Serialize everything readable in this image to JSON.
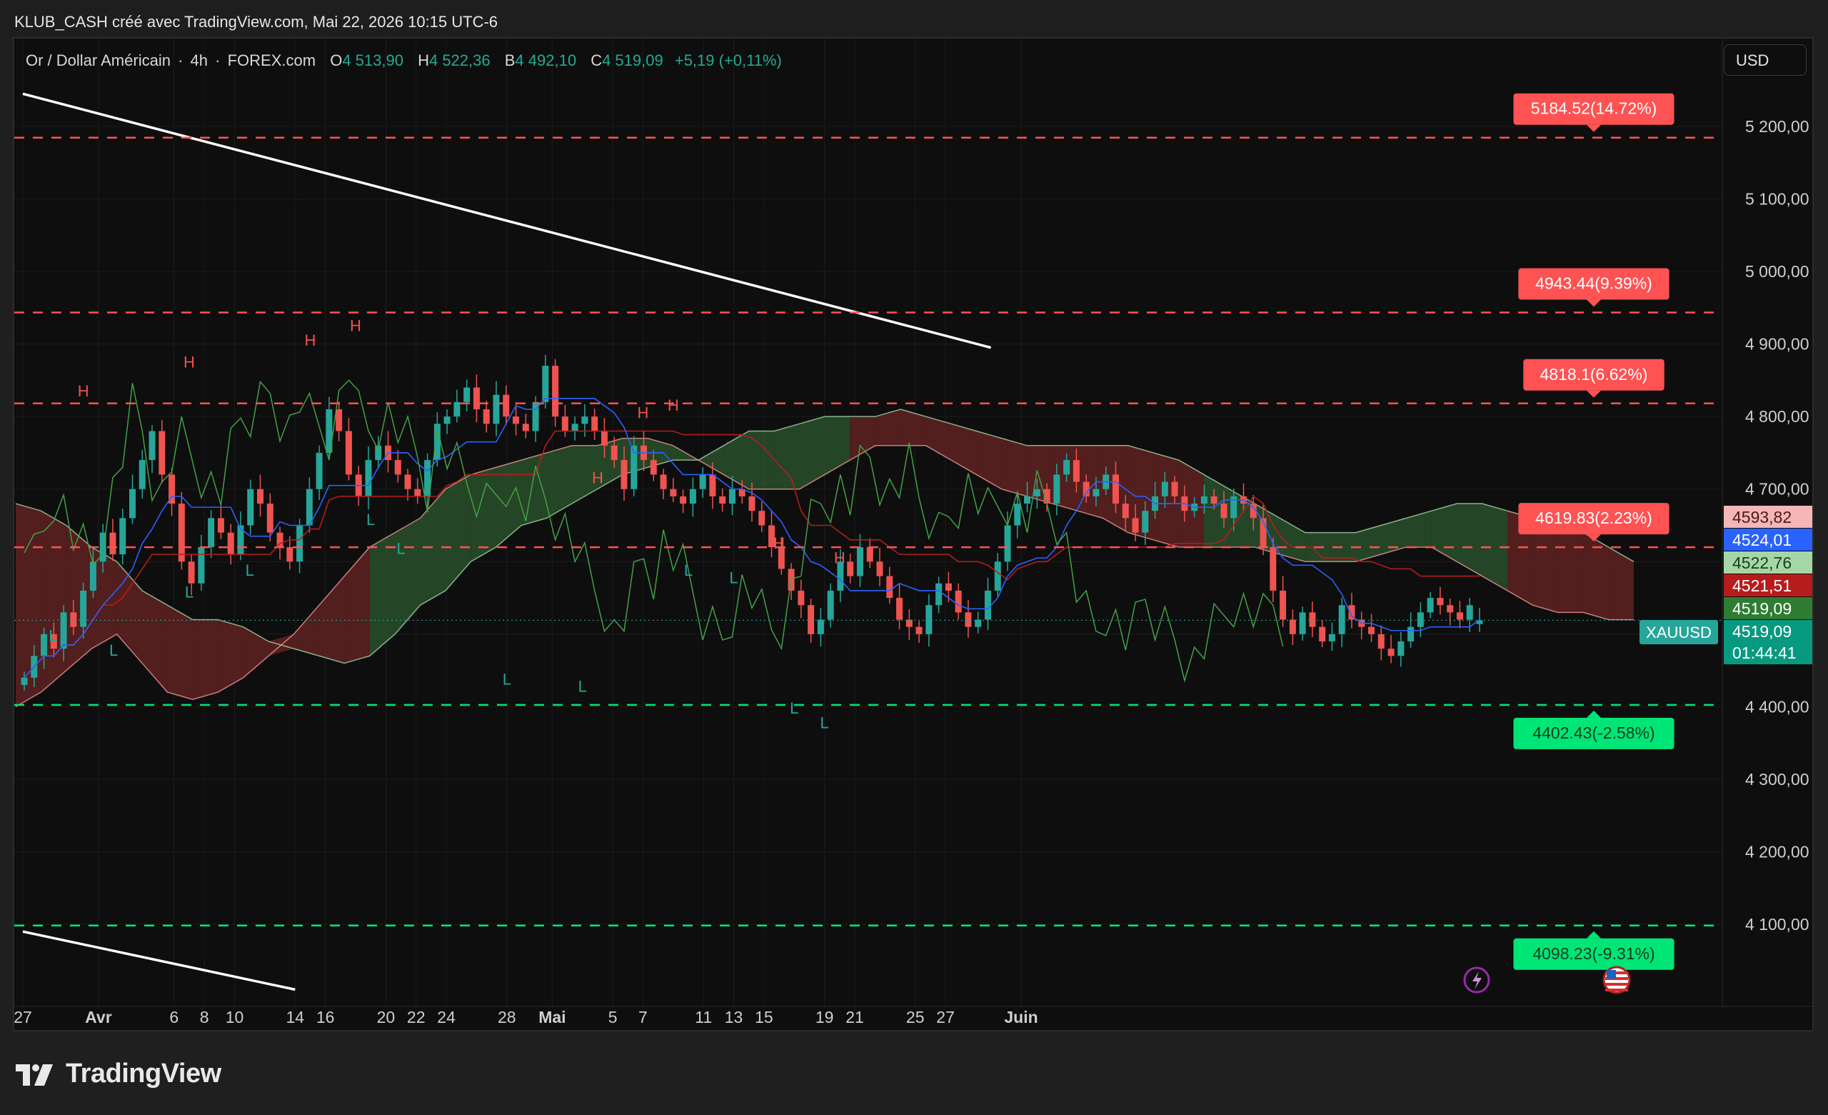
{
  "header": {
    "credit": "KLUB_CASH créé avec TradingView.com, Mai 22, 2026 10:15 UTC-6"
  },
  "legend": {
    "symbol_desc": "Or / Dollar Américain",
    "interval": "4h",
    "exchange": "FOREX.com",
    "open_label": "O",
    "open": "4 513,90",
    "high_label": "H",
    "high": "4 522,36",
    "low_label": "B",
    "low": "4 492,10",
    "close_label": "C",
    "close": "4 519,09",
    "change": "+5,19 (+0,11%)"
  },
  "currency": "USD",
  "footer": {
    "brand": "TradingView"
  },
  "colors": {
    "background": "#0e0e0e",
    "grid": "#1c1c1c",
    "up": "#26a69a",
    "down": "#ef5350",
    "resistance": "#ff5252",
    "support": "#00e676",
    "trendline": "#ffffff",
    "cloud_bull": "#2d5a2f",
    "cloud_bear": "#6b2424",
    "kijun": "#b71c1c",
    "tenkan": "#2962ff",
    "chikou": "#43a047"
  },
  "chart_data": {
    "type": "candlestick",
    "symbol": "XAUUSD",
    "interval": "4h",
    "y_scale": {
      "min": 4000,
      "max": 5300
    },
    "y_ticks": [
      {
        "value": 5200,
        "label": "5 200,00"
      },
      {
        "value": 5100,
        "label": "5 100,00"
      },
      {
        "value": 5000,
        "label": "5 000,00"
      },
      {
        "value": 4900,
        "label": "4 900,00"
      },
      {
        "value": 4800,
        "label": "4 800,00"
      },
      {
        "value": 4700,
        "label": "4 700,00"
      },
      {
        "value": 4400,
        "label": "4 400,00"
      },
      {
        "value": 4300,
        "label": "4 300,00"
      },
      {
        "value": 4200,
        "label": "4 200,00"
      },
      {
        "value": 4100,
        "label": "4 100,00"
      }
    ],
    "x_ticks": [
      {
        "label": "27",
        "date": "2026-03-27"
      },
      {
        "label": "Avr",
        "date": "2026-04-01",
        "bold": true
      },
      {
        "label": "6",
        "date": "2026-04-06"
      },
      {
        "label": "8",
        "date": "2026-04-08"
      },
      {
        "label": "10",
        "date": "2026-04-10"
      },
      {
        "label": "14",
        "date": "2026-04-14"
      },
      {
        "label": "16",
        "date": "2026-04-16"
      },
      {
        "label": "20",
        "date": "2026-04-20"
      },
      {
        "label": "22",
        "date": "2026-04-22"
      },
      {
        "label": "24",
        "date": "2026-04-24"
      },
      {
        "label": "28",
        "date": "2026-04-28"
      },
      {
        "label": "Mai",
        "date": "2026-05-01",
        "bold": true
      },
      {
        "label": "5",
        "date": "2026-05-05"
      },
      {
        "label": "7",
        "date": "2026-05-07"
      },
      {
        "label": "11",
        "date": "2026-05-11"
      },
      {
        "label": "13",
        "date": "2026-05-13"
      },
      {
        "label": "15",
        "date": "2026-05-15"
      },
      {
        "label": "19",
        "date": "2026-05-19"
      },
      {
        "label": "21",
        "date": "2026-05-21"
      },
      {
        "label": "25",
        "date": "2026-05-25"
      },
      {
        "label": "27",
        "date": "2026-05-27"
      },
      {
        "label": "Juin",
        "date": "2026-06-01",
        "bold": true
      }
    ],
    "closes": [
      4440,
      4470,
      4500,
      4480,
      4530,
      4510,
      4560,
      4600,
      4640,
      4610,
      4660,
      4700,
      4740,
      4780,
      4720,
      4680,
      4600,
      4570,
      4620,
      4660,
      4640,
      4610,
      4650,
      4700,
      4680,
      4640,
      4620,
      4600,
      4650,
      4700,
      4750,
      4810,
      4780,
      4720,
      4690,
      4740,
      4760,
      4740,
      4720,
      4700,
      4690,
      4740,
      4790,
      4800,
      4820,
      4840,
      4810,
      4790,
      4830,
      4800,
      4790,
      4780,
      4820,
      4870,
      4800,
      4780,
      4790,
      4800,
      4780,
      4760,
      4740,
      4700,
      4760,
      4740,
      4720,
      4700,
      4690,
      4680,
      4700,
      4720,
      4690,
      4680,
      4700,
      4690,
      4670,
      4650,
      4620,
      4590,
      4560,
      4540,
      4500,
      4520,
      4560,
      4600,
      4580,
      4620,
      4600,
      4580,
      4550,
      4520,
      4510,
      4500,
      4540,
      4570,
      4560,
      4530,
      4510,
      4520,
      4560,
      4600,
      4650,
      4680,
      4690,
      4700,
      4680,
      4720,
      4740,
      4710,
      4690,
      4700,
      4720,
      4680,
      4660,
      4640,
      4670,
      4690,
      4710,
      4690,
      4670,
      4680,
      4690,
      4680,
      4660,
      4690,
      4680,
      4660,
      4620,
      4560,
      4520,
      4500,
      4530,
      4510,
      4490,
      4500,
      4540,
      4520,
      4510,
      4500,
      4480,
      4470,
      4490,
      4510,
      4530,
      4550,
      4540,
      4530,
      4520,
      4540,
      4519.09
    ],
    "ohlc_last": {
      "open": 4513.9,
      "high": 4522.36,
      "low": 4492.1,
      "close": 4519.09
    },
    "cloud": {
      "upper": [
        4680,
        4670,
        4650,
        4620,
        4600,
        4560,
        4540,
        4520,
        4520,
        4510,
        4490,
        4480,
        4470,
        4460,
        4470,
        4500,
        4540,
        4560,
        4600,
        4620,
        4650,
        4660,
        4680,
        4700,
        4720,
        4730,
        4740,
        4740,
        4760,
        4780,
        4780,
        4790,
        4800,
        4800,
        4800,
        4810,
        4800,
        4790,
        4780,
        4770,
        4760,
        4760,
        4760,
        4760,
        4760,
        4750,
        4740,
        4720,
        4700,
        4680,
        4660,
        4640,
        4640,
        4640,
        4650,
        4660,
        4670,
        4680,
        4680,
        4670,
        4660,
        4650,
        4640,
        4620,
        4600
      ],
      "lower": [
        4400,
        4420,
        4450,
        4480,
        4500,
        4460,
        4420,
        4410,
        4420,
        4440,
        4470,
        4500,
        4540,
        4580,
        4620,
        4640,
        4660,
        4700,
        4720,
        4730,
        4740,
        4750,
        4760,
        4760,
        4770,
        4770,
        4760,
        4740,
        4720,
        4700,
        4700,
        4700,
        4720,
        4740,
        4760,
        4760,
        4760,
        4740,
        4720,
        4700,
        4690,
        4680,
        4670,
        4660,
        4640,
        4630,
        4620,
        4620,
        4620,
        4620,
        4610,
        4600,
        4600,
        4600,
        4610,
        4620,
        4620,
        4600,
        4580,
        4560,
        4540,
        4530,
        4530,
        4520,
        4520
      ]
    },
    "resistance_levels": [
      {
        "price": 5184.52,
        "label": "5184.52(14.72%)"
      },
      {
        "price": 4943.44,
        "label": "4943.44(9.39%)"
      },
      {
        "price": 4818.1,
        "label": "4818.1(6.62%)"
      },
      {
        "price": 4619.83,
        "label": "4619.83(2.23%)"
      }
    ],
    "support_levels": [
      {
        "price": 4402.43,
        "label": "4402.43(-2.58%)"
      },
      {
        "price": 4098.23,
        "label": "4098.23(-9.31%)"
      }
    ],
    "trendlines": [
      {
        "from": {
          "date": "2026-03-27",
          "price": 5245
        },
        "to": {
          "date": "2026-05-30",
          "price": 4895
        }
      },
      {
        "from": {
          "date": "2026-03-27",
          "price": 4090
        },
        "to": {
          "date": "2026-04-14",
          "price": 4010
        }
      }
    ],
    "price_labels": [
      {
        "value": "4593,82",
        "price": 4593.82,
        "bg": "#f5b6b6",
        "fg": "#4a1a1a"
      },
      {
        "value": "4524,01",
        "price": 4524.01,
        "bg": "#2962ff",
        "fg": "#ffffff"
      },
      {
        "value": "4522,76",
        "price": 4522.76,
        "bg": "#a5d6a7",
        "fg": "#1b3d1c"
      },
      {
        "value": "4521,51",
        "price": 4521.51,
        "bg": "#b71c1c",
        "fg": "#ffffff"
      },
      {
        "value": "4519,09",
        "price": 4519.09,
        "bg": "#2e7d32",
        "fg": "#ffffff"
      },
      {
        "value": "4519,09",
        "price": 4519.09,
        "bg": "#089981",
        "fg": "#ffffff"
      }
    ],
    "current_price": {
      "symbol_tag": "XAUUSD",
      "value": "4519,09",
      "countdown": "01:44:41"
    },
    "pivot_markers": [
      {
        "text": "H",
        "date": "2026-03-31",
        "price": 4820
      },
      {
        "text": "H",
        "date": "2026-04-07",
        "price": 4860
      },
      {
        "text": "H",
        "date": "2026-04-15",
        "price": 4890
      },
      {
        "text": "H",
        "date": "2026-04-18",
        "price": 4910
      },
      {
        "text": "H",
        "date": "2026-05-04",
        "price": 4700
      },
      {
        "text": "H",
        "date": "2026-05-07",
        "price": 4790
      },
      {
        "text": "H",
        "date": "2026-05-09",
        "price": 4800
      },
      {
        "text": "H",
        "date": "2026-05-16",
        "price": 4610
      },
      {
        "text": "H",
        "date": "2026-05-20",
        "price": 4590
      },
      {
        "text": "L",
        "date": "2026-03-29",
        "price": 4520
      },
      {
        "text": "L",
        "date": "2026-04-02",
        "price": 4500
      },
      {
        "text": "L",
        "date": "2026-04-07",
        "price": 4580
      },
      {
        "text": "L",
        "date": "2026-04-11",
        "price": 4610
      },
      {
        "text": "L",
        "date": "2026-04-19",
        "price": 4680
      },
      {
        "text": "L",
        "date": "2026-04-21",
        "price": 4640
      },
      {
        "text": "L",
        "date": "2026-04-28",
        "price": 4460
      },
      {
        "text": "L",
        "date": "2026-05-03",
        "price": 4450
      },
      {
        "text": "L",
        "date": "2026-05-10",
        "price": 4610
      },
      {
        "text": "L",
        "date": "2026-05-13",
        "price": 4600
      },
      {
        "text": "L",
        "date": "2026-05-17",
        "price": 4420
      },
      {
        "text": "L",
        "date": "2026-05-19",
        "price": 4400
      }
    ]
  }
}
